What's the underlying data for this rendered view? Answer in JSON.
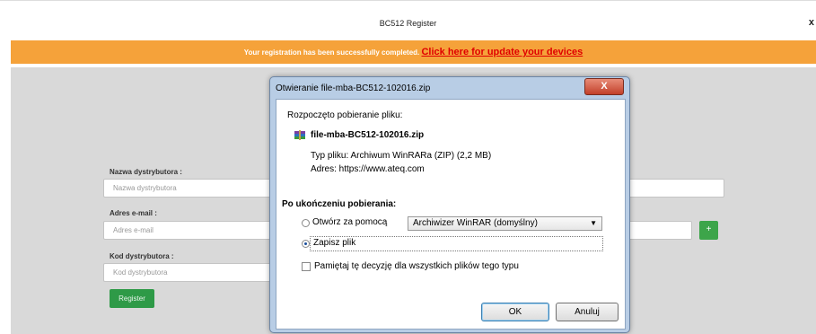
{
  "header": {
    "title": "BC512 Register",
    "close_glyph": "x"
  },
  "banner": {
    "message": "Your registration has been successfully completed.",
    "link_text": "Click here for update your devices"
  },
  "form": {
    "distributor_name_label": "Nazwa dystrybutora :",
    "distributor_name_placeholder": "Nazwa dystrybutora",
    "email_label": "Adres e-mail :",
    "email_placeholder": "Adres e-mail",
    "distributor_code_label": "Kod dystrybutora :",
    "distributor_code_placeholder": "Kod dystrybutora",
    "register_label": "Register",
    "plus_label": "+"
  },
  "dialog": {
    "title": "Otwieranie file-mba-BC512-102016.zip",
    "close_label": "X",
    "started_text": "Rozpoczęto pobieranie pliku:",
    "file_name": "file-mba-BC512-102016.zip",
    "file_type": "Typ pliku: Archiwum WinRARa (ZIP) (2,2 MB)",
    "address": "Adres: https://www.ateq.com",
    "after_download_heading": "Po ukończeniu pobierania:",
    "open_with_label": "Otwórz za pomocą",
    "open_with_app": "Archiwizer WinRAR (domyślny)",
    "save_file_label": "Zapisz plik",
    "remember_label": "Pamiętaj tę decyzję dla wszystkich plików tego typu",
    "ok_label": "OK",
    "cancel_label": "Anuluj",
    "selected_option": "save_file",
    "remember_checked": false
  },
  "colors": {
    "banner_bg": "#f5a23a",
    "banner_link": "#e00000",
    "register_button": "#2e9a47",
    "dialog_frame": "#b8cde5"
  }
}
